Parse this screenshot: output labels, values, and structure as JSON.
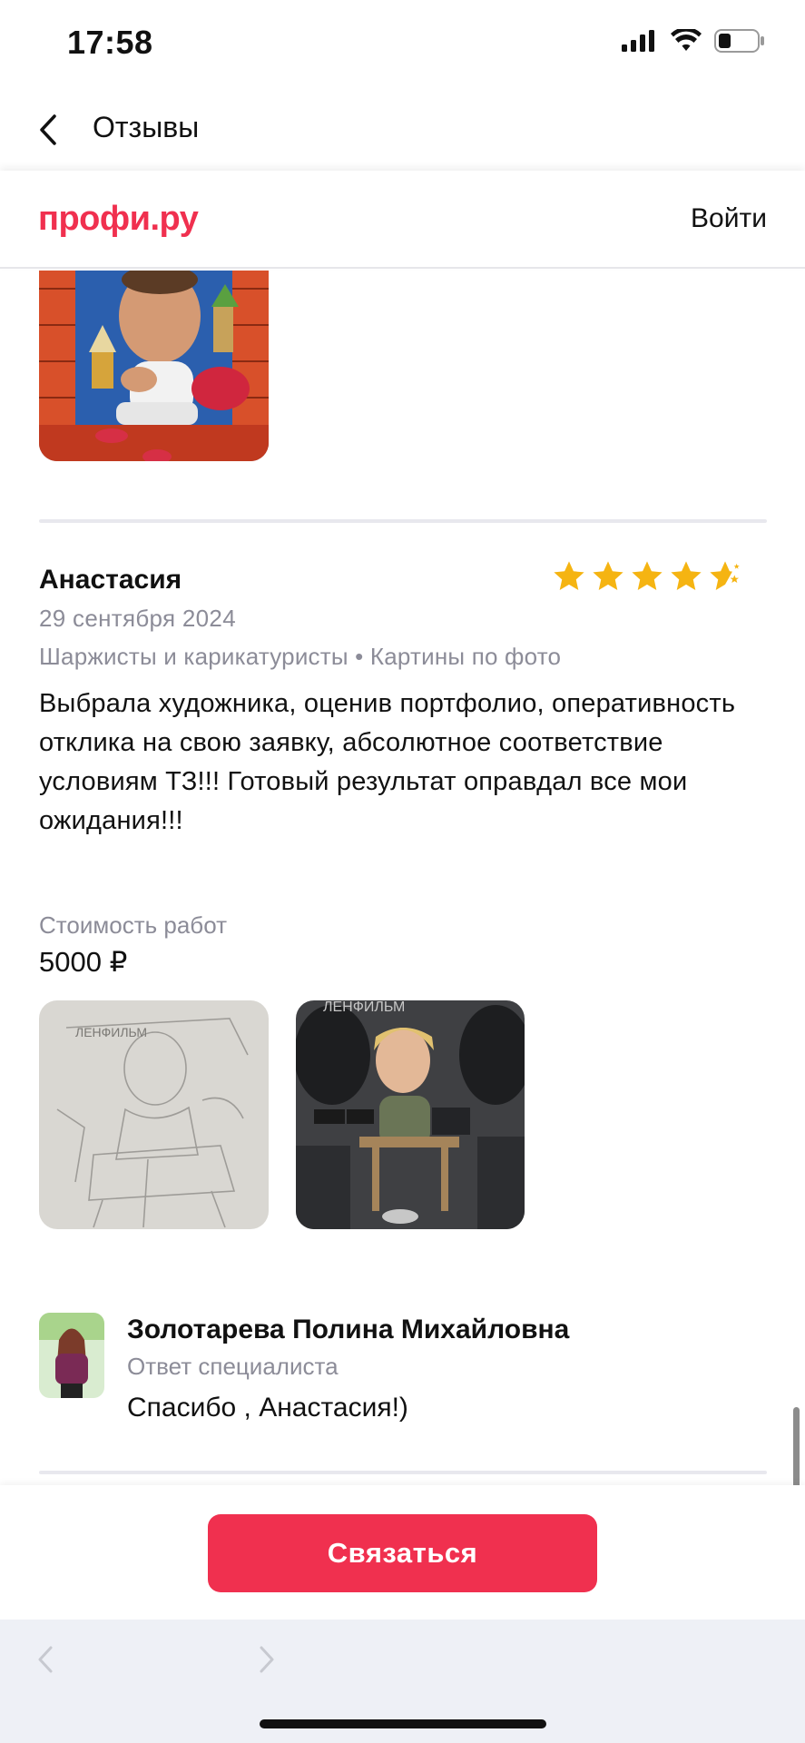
{
  "status_bar": {
    "time": "17:58"
  },
  "nav": {
    "title": "Отзывы"
  },
  "header": {
    "logo": "профи.ру",
    "login": "Войти"
  },
  "review": {
    "author": "Анастасия",
    "date": "29 сентября 2024",
    "categories": "Шаржисты и карикатуристы • Картины по фото",
    "rating": 4.5,
    "text": "Выбрала художника, оценив портфолио, оперативность отклика на свою заявку, абсолютное соответствие условиям ТЗ!!! Готовый результат оправдал все мои ожидания!!!",
    "cost_label": "Стоимость работ",
    "cost_value": "5000 ₽"
  },
  "reply": {
    "name": "Золотарева Полина Михайловна",
    "role": "Ответ специалиста",
    "text": "Спасибо , Анастасия!)"
  },
  "actions": {
    "contact": "Связаться"
  },
  "colors": {
    "brand": "#f0304f",
    "star": "#f5b412",
    "muted": "#8c8c98"
  }
}
